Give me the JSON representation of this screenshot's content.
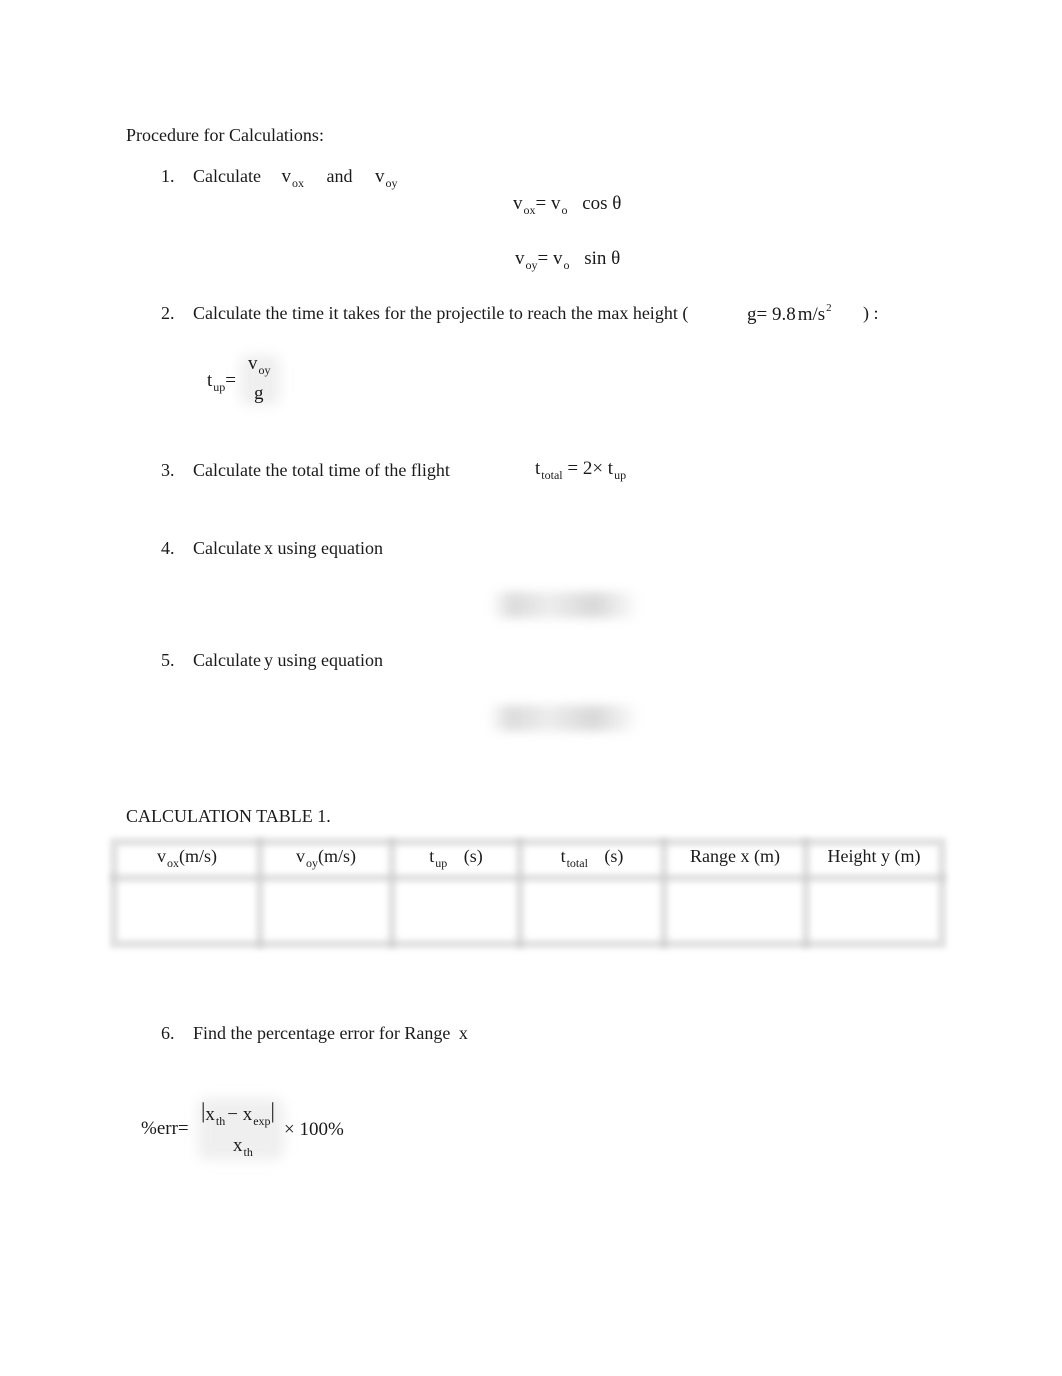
{
  "heading": "Procedure for Calculations:",
  "steps": [
    {
      "number": "1.",
      "text": "Calculate",
      "var1": {
        "base": "v",
        "sub": "ox"
      },
      "connector": "and",
      "var2": {
        "base": "v",
        "sub": "oy"
      },
      "equations": [
        {
          "lhs_base": "v",
          "lhs_sub": "ox",
          "eq": "=",
          "rhs_base": "v",
          "rhs_sub": "o",
          "func": "cos θ"
        },
        {
          "lhs_base": "v",
          "lhs_sub": "oy",
          "eq": "=",
          "rhs_base": "v",
          "rhs_sub": "o",
          "func": "sin θ"
        }
      ]
    },
    {
      "number": "2.",
      "text": "Calculate the time it takes for the projectile to reach the max height (",
      "gravity": {
        "symbol": "g=",
        "value": "9.8",
        "unit": "m/s",
        "exp": "2"
      },
      "text_end": ") :",
      "equation": {
        "lhs_base": "t",
        "lhs_sub": "up",
        "eq": "=",
        "num_base": "v",
        "num_sub": "oy",
        "den": "g"
      }
    },
    {
      "number": "3.",
      "text": "Calculate the total time of the flight",
      "equation": {
        "lhs_base": "t",
        "lhs_sub": "total",
        "eq": "= 2×",
        "rhs_base": "t",
        "rhs_sub": "up"
      }
    },
    {
      "number": "4.",
      "text_pre": "Calculate",
      "var": "x",
      "text_post": "using equation",
      "equation_blurred": true
    },
    {
      "number": "5.",
      "text_pre": "Calculate",
      "var": "y",
      "text_post": "using equation",
      "equation_blurred": true
    },
    {
      "number": "6.",
      "text": "Find the percentage error for Range",
      "var": "x",
      "equation": {
        "lhs": "%err",
        "eq": "=",
        "num_a_base": "x",
        "num_a_sub": "th",
        "minus": "−",
        "num_b_base": "x",
        "num_b_sub": "exp",
        "den_base": "x",
        "den_sub": "th",
        "times": "× 100%"
      }
    }
  ],
  "table": {
    "title": "CALCULATION TABLE 1.",
    "headers": [
      {
        "base": "v",
        "sub": "ox",
        "unit": "(m/s)"
      },
      {
        "base": "v",
        "sub": "oy",
        "unit": "(m/s)"
      },
      {
        "base": "t",
        "sub": "up",
        "unit": "(s)"
      },
      {
        "base": "t",
        "sub": "total",
        "unit": "(s)"
      },
      {
        "base": "Range x (m)",
        "sub": "",
        "unit": ""
      },
      {
        "base": "Height y (m)",
        "sub": "",
        "unit": ""
      }
    ],
    "rows": [
      [
        "",
        "",
        "",
        "",
        "",
        ""
      ]
    ]
  }
}
